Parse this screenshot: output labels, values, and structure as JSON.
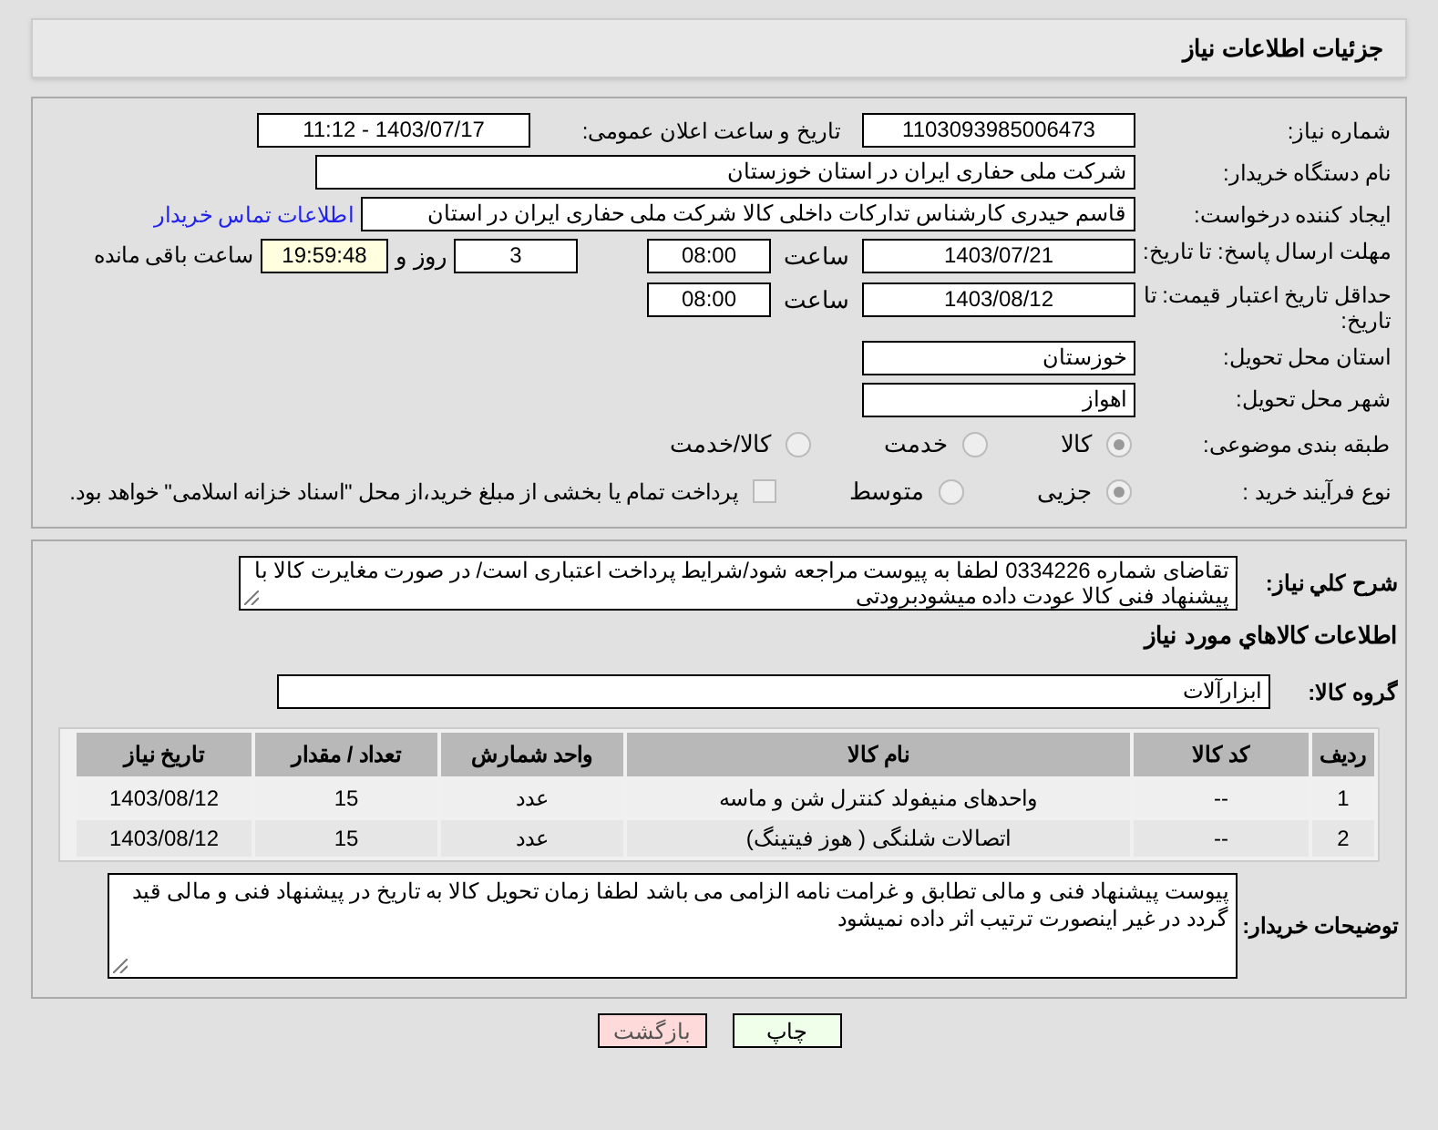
{
  "header": {
    "title": "جزئیات اطلاعات نیاز"
  },
  "need_number": {
    "label": "شماره نیاز:",
    "value": "1103093985006473"
  },
  "announce_date": {
    "label": "تاریخ و ساعت اعلان عمومی:",
    "value": "1403/07/17 - 11:12"
  },
  "buyer_org": {
    "label": "نام دستگاه خریدار:",
    "value": "شرکت ملی حفاری ایران در استان خوزستان"
  },
  "requester": {
    "label": "ایجاد کننده درخواست:",
    "value": "قاسم حیدری کارشناس تدارکات داخلی کالا شرکت ملی حفاری ایران در استان",
    "link": "اطلاعات تماس خریدار"
  },
  "deadline": {
    "label": "مهلت ارسال پاسخ: تا تاریخ:",
    "date": "1403/07/21",
    "time_label": "ساعت",
    "time": "08:00",
    "days": "3",
    "days_label": "روز و",
    "remaining": "19:59:48",
    "remaining_label": "ساعت باقی مانده"
  },
  "price_validity": {
    "label": "حداقل تاریخ اعتبار قیمت: تا تاریخ:",
    "date": "1403/08/12",
    "time_label": "ساعت",
    "time": "08:00"
  },
  "province": {
    "label": "استان محل تحویل:",
    "value": "خوزستان"
  },
  "city": {
    "label": "شهر محل تحویل:",
    "value": "اهواز"
  },
  "category": {
    "label": "طبقه بندی موضوعی:",
    "options": [
      {
        "label": "کالا",
        "selected": true
      },
      {
        "label": "خدمت",
        "selected": false
      },
      {
        "label": "کالا/خدمت",
        "selected": false
      }
    ]
  },
  "process": {
    "label": "نوع فرآیند خرید :",
    "options": [
      {
        "label": "جزیی",
        "selected": true
      },
      {
        "label": "متوسط",
        "selected": false
      }
    ],
    "treasury": {
      "checked": false,
      "label": "پرداخت تمام یا بخشی از مبلغ خرید،از محل \"اسناد خزانه اسلامی\" خواهد بود."
    }
  },
  "description": {
    "label": "شرح کلي نیاز:",
    "value": "تقاضای شماره 0334226 لطفا به پیوست مراجعه شود/شرایط پرداخت اعتباری است/ در صورت مغایرت کالا با پیشنهاد فنی کالا عودت داده میشودبرودتی"
  },
  "goods_heading": "اطلاعات کالاهاي مورد نیاز",
  "goods_group": {
    "label": "گروه کالا:",
    "value": "ابزارآلات"
  },
  "table": {
    "columns": [
      "ردیف",
      "کد کالا",
      "نام کالا",
      "واحد شمارش",
      "تعداد / مقدار",
      "تاریخ نیاز"
    ],
    "rows": [
      [
        "1",
        "--",
        "واحدهای منیفولد کنترل شن و ماسه",
        "عدد",
        "15",
        "1403/08/12"
      ],
      [
        "2",
        "--",
        "اتصالات شلنگی ( هوز فیتینگ)",
        "عدد",
        "15",
        "1403/08/12"
      ]
    ]
  },
  "buyer_notes": {
    "label": "توضیحات خریدار:",
    "value": "پیوست پیشنهاد فنی و مالی تطابق و غرامت نامه الزامی می باشد لطفا زمان تحویل کالا به تاریخ در پیشنهاد فنی و مالی قید گردد در غیر اینصورت ترتیب اثر داده نمیشود"
  },
  "buttons": [
    {
      "kind": "print",
      "label": "چاپ"
    },
    {
      "kind": "back",
      "label": "بازگشت"
    }
  ]
}
